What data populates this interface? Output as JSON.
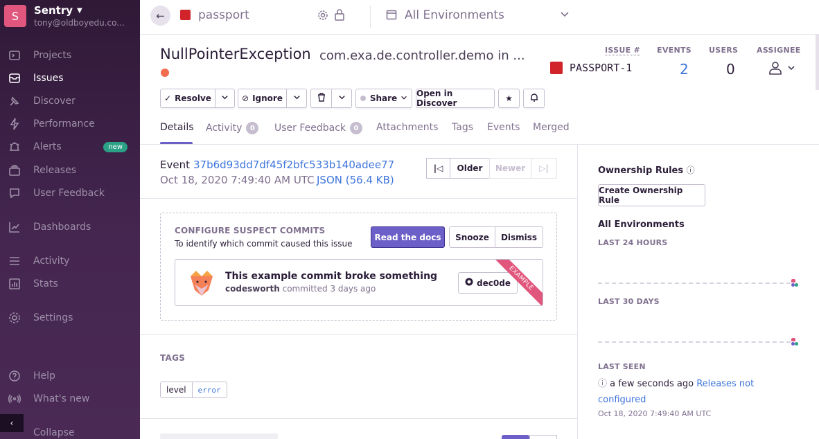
{
  "org": {
    "avatar_letter": "S",
    "name": "Sentry",
    "email": "tony@oldboyedu.co..."
  },
  "sidebar": {
    "items": [
      {
        "label": "Projects",
        "icon": "projects-icon"
      },
      {
        "label": "Issues",
        "icon": "issues-icon"
      },
      {
        "label": "Discover",
        "icon": "discover-icon"
      },
      {
        "label": "Performance",
        "icon": "performance-icon"
      },
      {
        "label": "Alerts",
        "icon": "alerts-icon",
        "badge": "new"
      },
      {
        "label": "Releases",
        "icon": "releases-icon"
      },
      {
        "label": "User Feedback",
        "icon": "user-feedback-icon"
      },
      {
        "label": "Dashboards",
        "icon": "dashboards-icon"
      },
      {
        "label": "Activity",
        "icon": "activity-icon"
      },
      {
        "label": "Stats",
        "icon": "stats-icon"
      },
      {
        "label": "Settings",
        "icon": "settings-icon"
      },
      {
        "label": "Help",
        "icon": "help-icon"
      },
      {
        "label": "What's new",
        "icon": "broadcast-icon"
      },
      {
        "label": "Collapse",
        "icon": "collapse-icon"
      }
    ],
    "active_index": 1,
    "accent_color": "#2ba185"
  },
  "topbar": {
    "project": "passport",
    "environment": "All Environments"
  },
  "issue": {
    "title": "NullPointerException",
    "subtitle": "com.exa.de.controller.demo in ...",
    "level_color": "#f36e4f",
    "short_id": "PASSPORT-1",
    "stats": {
      "issue_label": "ISSUE #",
      "events_label": "EVENTS",
      "users_label": "USERS",
      "assignee_label": "ASSIGNEE",
      "events": "2",
      "users": "0"
    }
  },
  "actions": {
    "resolve": "Resolve",
    "ignore": "Ignore",
    "share": "Share",
    "open_in_discover": "Open in Discover"
  },
  "tabs": [
    {
      "label": "Details"
    },
    {
      "label": "Activity",
      "count": "0"
    },
    {
      "label": "User Feedback",
      "count": "0"
    },
    {
      "label": "Attachments"
    },
    {
      "label": "Tags"
    },
    {
      "label": "Events"
    },
    {
      "label": "Merged"
    }
  ],
  "event": {
    "label": "Event",
    "id": "37b6d93dd7df45f2bfc533b140adee77",
    "date": "Oct 18, 2020 7:49:40 AM UTC",
    "json": "JSON (56.4 KB)",
    "older": "Older",
    "newer": "Newer"
  },
  "suspect": {
    "title": "CONFIGURE SUSPECT COMMITS",
    "subtitle": "To identify which commit caused this issue",
    "read_docs": "Read the docs",
    "snooze": "Snooze",
    "dismiss": "Dismiss",
    "commit_message": "This example commit broke something",
    "commit_author": "codesworth",
    "commit_suffix": "committed 3 days ago",
    "commit_sha": "dec0de",
    "ribbon": "EXAMPLE"
  },
  "tags": {
    "title": "TAGS",
    "items": [
      {
        "key": "level",
        "value": "error"
      }
    ]
  },
  "right": {
    "ownership_rules": "Ownership Rules",
    "create_rule": "Create Ownership Rule",
    "environments": "All Environments",
    "last_24h": "LAST 24 HOURS",
    "last_30d": "LAST 30 DAYS",
    "last_seen": "LAST SEEN",
    "last_seen_ago": "a few seconds ago",
    "releases_link": "Releases not configured",
    "last_seen_date": "Oct 18, 2020 7:49:40 AM UTC"
  }
}
